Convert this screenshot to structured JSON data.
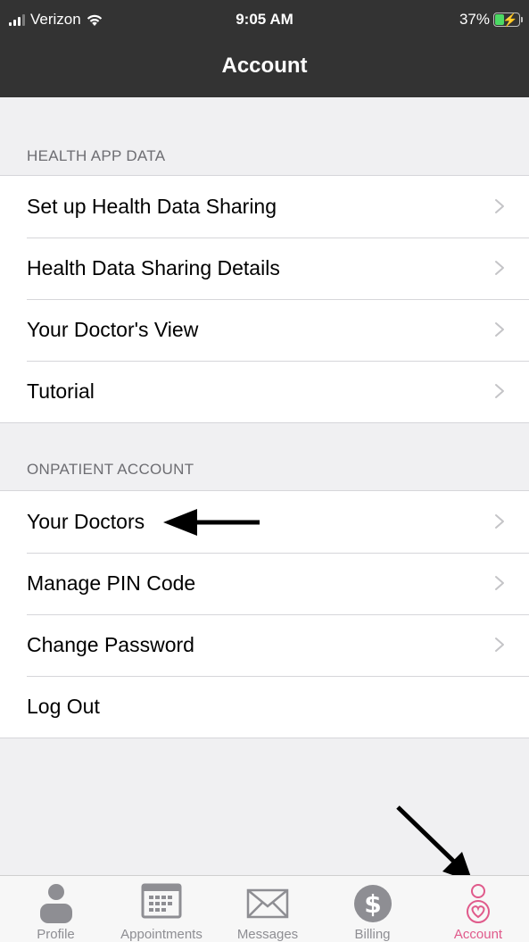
{
  "status_bar": {
    "carrier": "Verizon",
    "time": "9:05 AM",
    "battery_percent": "37%",
    "battery_level": 0.37
  },
  "nav": {
    "title": "Account"
  },
  "sections": [
    {
      "header": "HEALTH APP DATA",
      "items": [
        {
          "label": "Set up Health Data Sharing",
          "chevron": true
        },
        {
          "label": "Health Data Sharing Details",
          "chevron": true
        },
        {
          "label": "Your Doctor's View",
          "chevron": true
        },
        {
          "label": "Tutorial",
          "chevron": true
        }
      ]
    },
    {
      "header": "ONPATIENT ACCOUNT",
      "items": [
        {
          "label": "Your Doctors",
          "chevron": true
        },
        {
          "label": "Manage PIN Code",
          "chevron": true
        },
        {
          "label": "Change Password",
          "chevron": true
        },
        {
          "label": "Log Out",
          "chevron": false
        }
      ]
    }
  ],
  "tab_bar": {
    "active": "Account",
    "tabs": [
      {
        "label": "Profile",
        "icon": "person-icon"
      },
      {
        "label": "Appointments",
        "icon": "calendar-icon"
      },
      {
        "label": "Messages",
        "icon": "envelope-icon"
      },
      {
        "label": "Billing",
        "icon": "dollar-icon"
      },
      {
        "label": "Account",
        "icon": "account-heart-icon"
      }
    ]
  },
  "colors": {
    "header_bg": "#333333",
    "page_bg": "#f0f0f2",
    "active_tab": "#e05a8b",
    "inactive_tab": "#8e8e93",
    "battery_green": "#4cd964"
  }
}
